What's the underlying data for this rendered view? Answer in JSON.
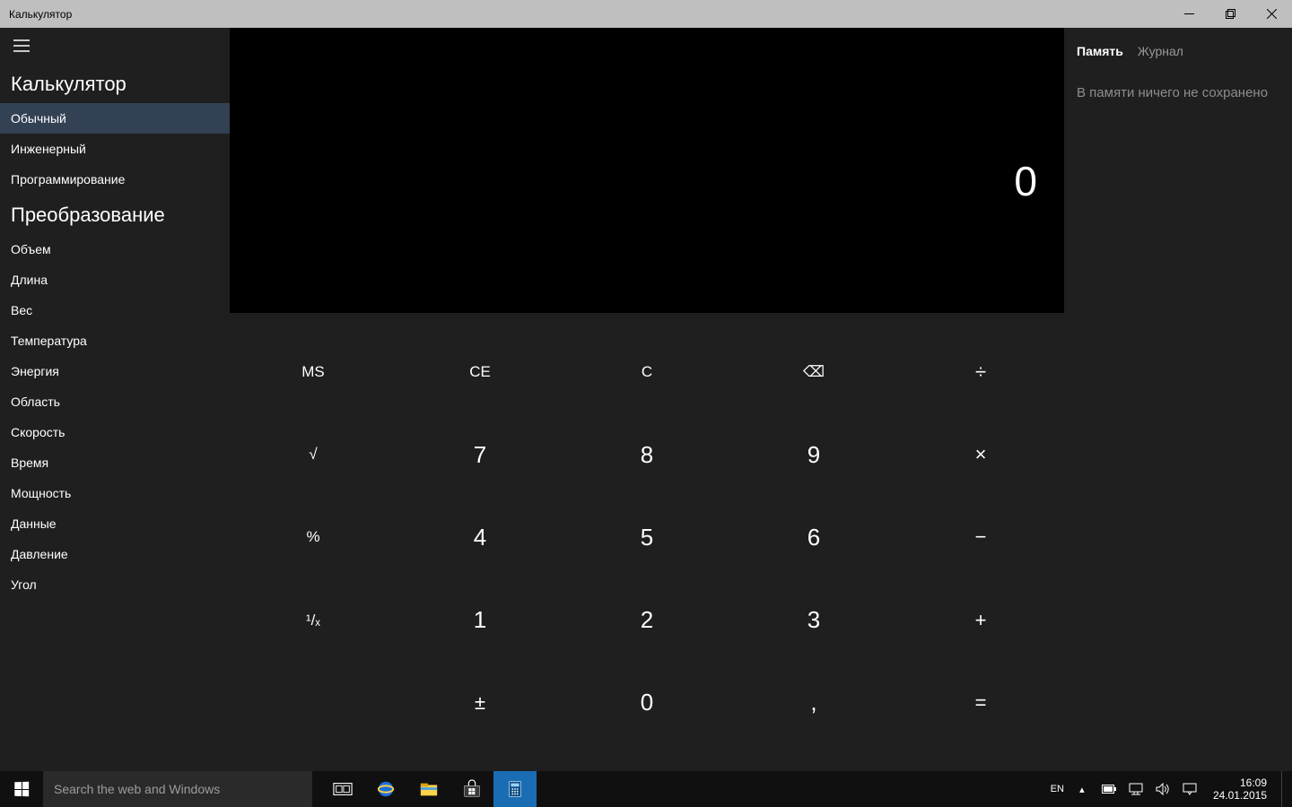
{
  "titlebar": {
    "title": "Калькулятор"
  },
  "sidebar": {
    "section1_title": "Калькулятор",
    "section2_title": "Преобразование",
    "modes": [
      {
        "label": "Обычный",
        "active": true
      },
      {
        "label": "Инженерный",
        "active": false
      },
      {
        "label": "Программирование",
        "active": false
      }
    ],
    "conversions": [
      {
        "label": "Объем"
      },
      {
        "label": "Длина"
      },
      {
        "label": "Вес"
      },
      {
        "label": "Температура"
      },
      {
        "label": "Энергия"
      },
      {
        "label": "Область"
      },
      {
        "label": "Скорость"
      },
      {
        "label": "Время"
      },
      {
        "label": "Мощность"
      },
      {
        "label": "Данные"
      },
      {
        "label": "Давление"
      },
      {
        "label": "Угол"
      }
    ]
  },
  "display": {
    "value": "0"
  },
  "keypad": {
    "rows": [
      [
        "MS",
        "CE",
        "C",
        "⌫",
        "÷"
      ],
      [
        "√",
        "7",
        "8",
        "9",
        "×"
      ],
      [
        "%",
        "4",
        "5",
        "6",
        "−"
      ],
      [
        "¹/ₓ",
        "1",
        "2",
        "3",
        "+"
      ],
      [
        "",
        "±",
        "0",
        ",",
        "="
      ]
    ]
  },
  "rightpanel": {
    "tab_memory": "Память",
    "tab_history": "Журнал",
    "empty": "В памяти ничего не сохранено"
  },
  "taskbar": {
    "search_placeholder": "Search the web and Windows",
    "lang": "EN",
    "time": "16:09",
    "date": "24.01.2015"
  }
}
